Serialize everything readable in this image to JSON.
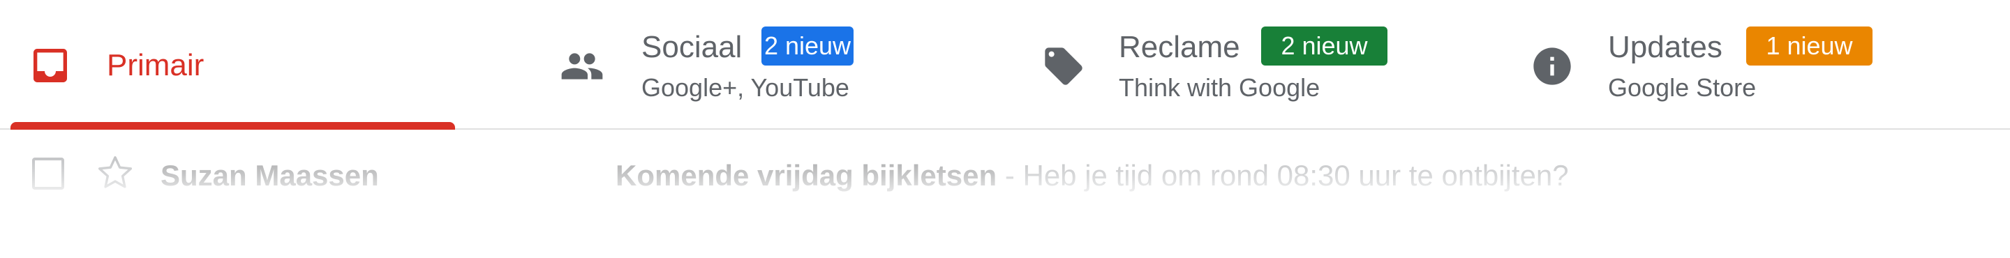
{
  "tabs": {
    "primary": {
      "label": "Primair",
      "icon": "inbox-icon",
      "color": "#d93025",
      "active": true
    },
    "social": {
      "title": "Sociaal",
      "badge": "2 nieuw",
      "badge_color": "#1a73e8",
      "subtitle": "Google+, YouTube",
      "icon": "people-icon"
    },
    "promotions": {
      "title": "Reclame",
      "badge": "2 nieuw",
      "badge_color": "#188038",
      "subtitle": "Think with Google",
      "icon": "tag-icon"
    },
    "updates": {
      "title": "Updates",
      "badge": "1 nieuw",
      "badge_color": "#ea8600",
      "subtitle": "Google Store",
      "icon": "info-icon"
    }
  },
  "mail_row": {
    "sender": "Suzan Maassen",
    "subject": "Komende vrijdag bijkletsen",
    "separator": " - ",
    "snippet": "Heb je tijd om rond 08:30 uur te ontbijten?"
  }
}
